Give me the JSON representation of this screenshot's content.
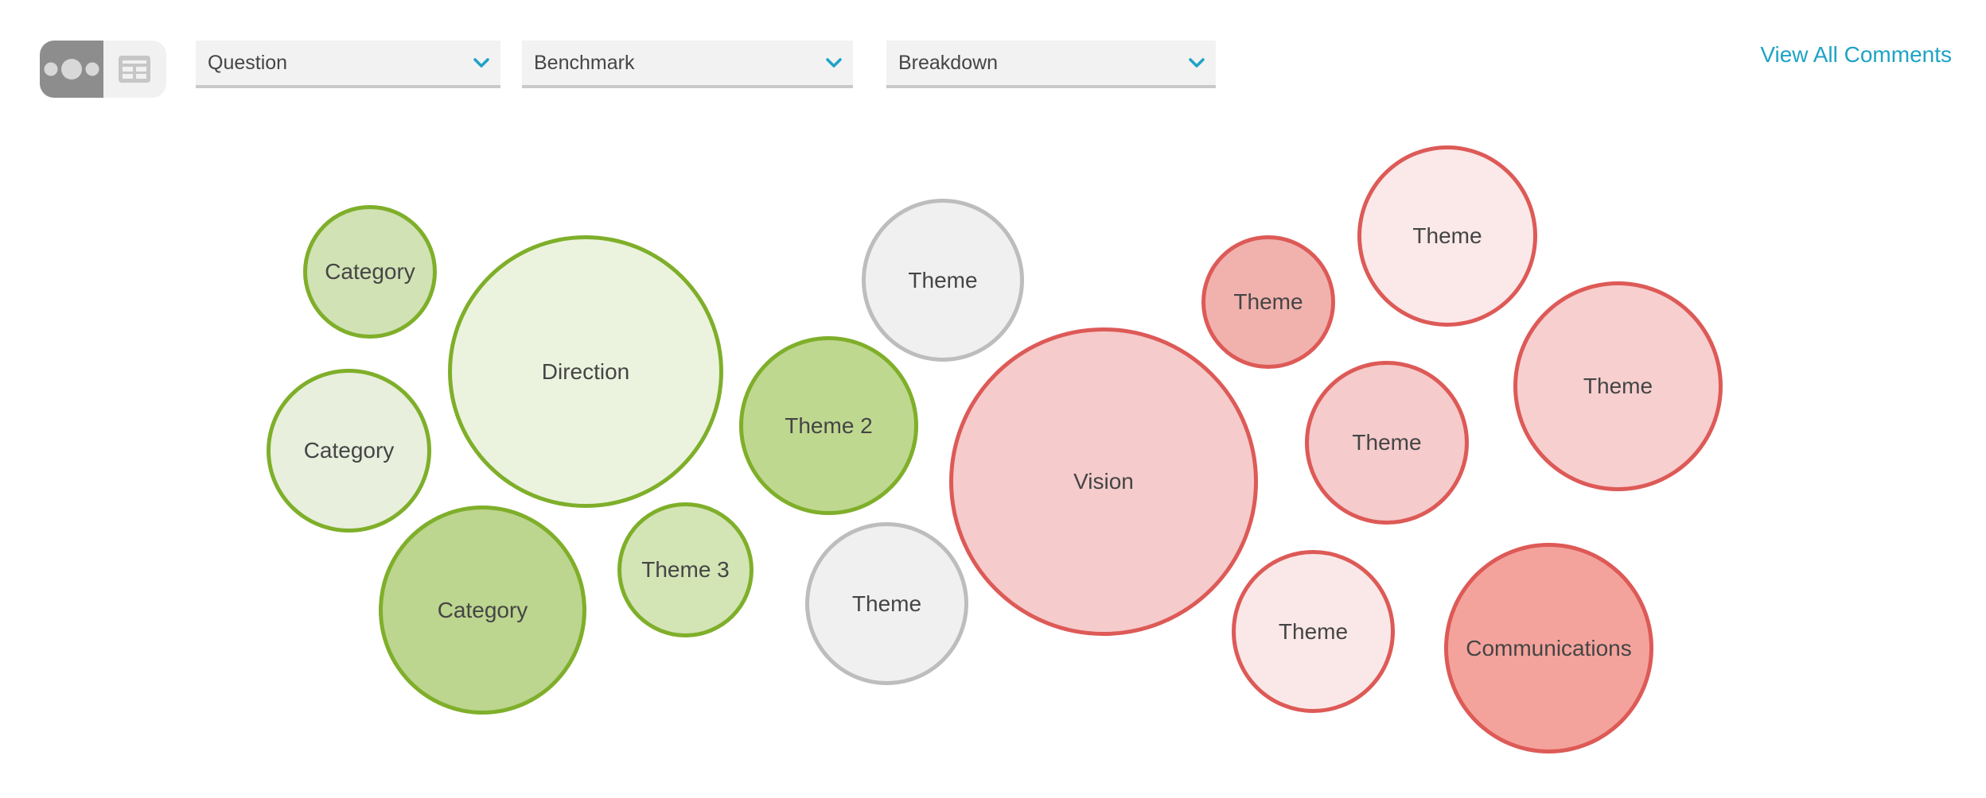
{
  "toolbar": {
    "view_toggle": {
      "bubble_view_icon": "bubble-view-icon",
      "table_view_icon": "table-view-icon",
      "active": "bubble"
    },
    "dropdowns": [
      {
        "label": "Question",
        "icon": "chevron-down-icon"
      },
      {
        "label": "Benchmark",
        "icon": "chevron-down-icon"
      },
      {
        "label": "Breakdown",
        "icon": "chevron-down-icon"
      }
    ],
    "view_all_link": "View All Comments"
  },
  "colors": {
    "accent": "#1ea3c6",
    "green_border": "#7faf2a",
    "red_border": "#dd5a57",
    "gray_border": "#bdbdbd"
  },
  "bubbles": [
    {
      "label": "Category",
      "sentiment": "positive",
      "fill": "#d1e2b5",
      "border": "#7faf2a"
    },
    {
      "label": "Direction",
      "sentiment": "positive",
      "fill": "#ebf3de",
      "border": "#7faf2a"
    },
    {
      "label": "Category",
      "sentiment": "positive",
      "fill": "#e8efdd",
      "border": "#7faf2a"
    },
    {
      "label": "Category",
      "sentiment": "positive",
      "fill": "#bcd58f",
      "border": "#7faf2a"
    },
    {
      "label": "Theme 3",
      "sentiment": "positive",
      "fill": "#d3e4b5",
      "border": "#7faf2a"
    },
    {
      "label": "Theme 2",
      "sentiment": "positive",
      "fill": "#bfd890",
      "border": "#7faf2a"
    },
    {
      "label": "Theme",
      "sentiment": "neutral",
      "fill": "#f0f0f0",
      "border": "#bdbdbd"
    },
    {
      "label": "Theme",
      "sentiment": "neutral",
      "fill": "#f0f0f0",
      "border": "#bdbdbd"
    },
    {
      "label": "Vision",
      "sentiment": "negative",
      "fill": "#f5cbcb",
      "border": "#dd5a57"
    },
    {
      "label": "Theme",
      "sentiment": "negative",
      "fill": "#f1b2ae",
      "border": "#dd5a57"
    },
    {
      "label": "Theme",
      "sentiment": "negative",
      "fill": "#fbe8e8",
      "border": "#dd5a57"
    },
    {
      "label": "Theme",
      "sentiment": "negative",
      "fill": "#f5cbcb",
      "border": "#dd5a57"
    },
    {
      "label": "Theme",
      "sentiment": "negative",
      "fill": "#f7cfcf",
      "border": "#dd5a57"
    },
    {
      "label": "Theme",
      "sentiment": "negative",
      "fill": "#fae8e8",
      "border": "#dd5a57"
    },
    {
      "label": "Communications",
      "sentiment": "negative",
      "fill": "#f4a39c",
      "border": "#dd5a57"
    }
  ]
}
